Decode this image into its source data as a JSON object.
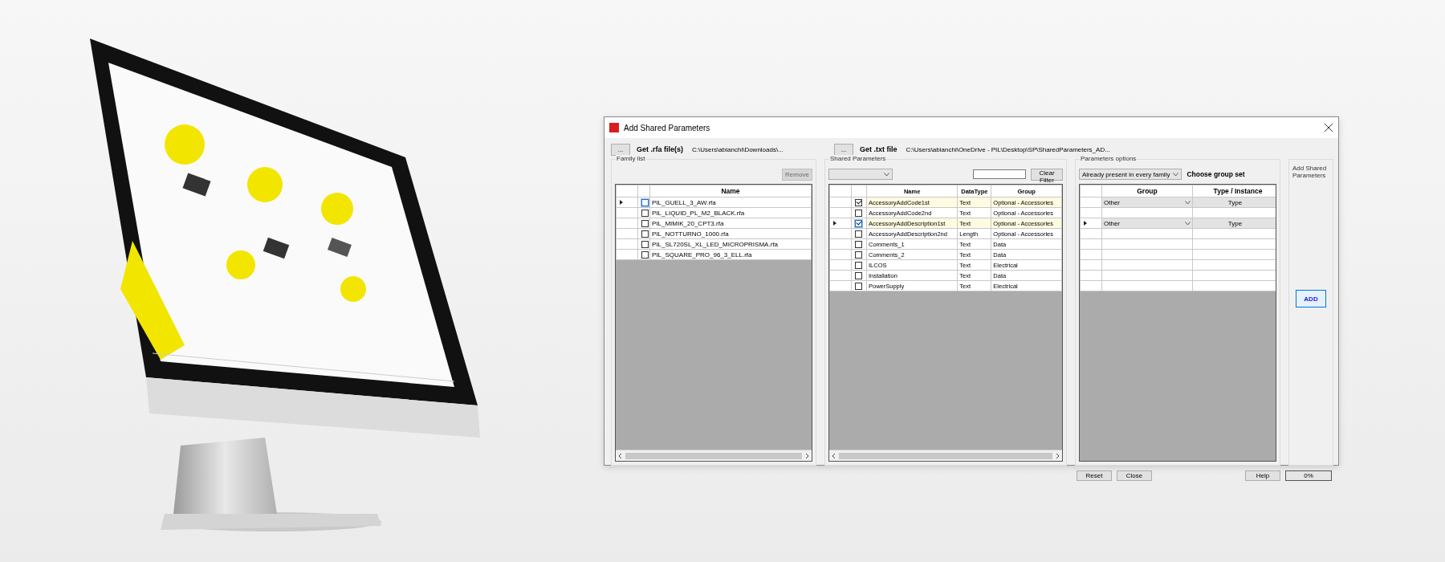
{
  "dialog": {
    "title": "Add Shared Parameters",
    "rfa_picker": {
      "button": "...",
      "label": "Get .rfa file(s)",
      "path": "C:\\Users\\abianchi\\Downloads\\..."
    },
    "txt_picker": {
      "button": "...",
      "label": "Get .txt file",
      "path": "C:\\Users\\abianchi\\OneDrive - PIL\\Desktop\\SP\\SharedParameters_AD..."
    },
    "family_list": {
      "title": "Family list",
      "remove_button": {
        "label": "Remove",
        "disabled": true
      },
      "columns": [
        "Name"
      ],
      "rows": [
        {
          "name": "PIL_GUELL_3_AW.rfa",
          "checked": false,
          "current": true
        },
        {
          "name": "PIL_LIQUID_PL_M2_BLACK.rfa",
          "checked": false,
          "current": false
        },
        {
          "name": "PIL_MIMIK_20_CPT3.rfa",
          "checked": false,
          "current": false
        },
        {
          "name": "PIL_NOTTURNO_1000.rfa",
          "checked": false,
          "current": false
        },
        {
          "name": "PIL_SL720SL_XL_LED_MICROPRISMA.rfa",
          "checked": false,
          "current": false
        },
        {
          "name": "PIL_SQUARE_PRO_96_3_ELL.rfa",
          "checked": false,
          "current": false
        }
      ]
    },
    "shared_parameters": {
      "title": "Shared Parameters",
      "clear_filter_button": "Clear Filter",
      "columns": [
        "Name",
        "DataType",
        "Group"
      ],
      "rows": [
        {
          "name": "AccessoryAddCode1st",
          "datatype": "Text",
          "group": "Optional - Accessories",
          "checked": true,
          "current": false
        },
        {
          "name": "AccessoryAddCode2nd",
          "datatype": "Text",
          "group": "Optional - Accessories",
          "checked": false,
          "current": false
        },
        {
          "name": "AccessoryAddDescription1st",
          "datatype": "Text",
          "group": "Optional - Accessories",
          "checked": true,
          "current": true
        },
        {
          "name": "AccessoryAddDescription2nd",
          "datatype": "Length",
          "group": "Optional - Accessories",
          "checked": false,
          "current": false
        },
        {
          "name": "Comments_1",
          "datatype": "Text",
          "group": "Data",
          "checked": false,
          "current": false
        },
        {
          "name": "Comments_2",
          "datatype": "Text",
          "group": "Data",
          "checked": false,
          "current": false
        },
        {
          "name": "ILCOS",
          "datatype": "Text",
          "group": "Electrical",
          "checked": false,
          "current": false
        },
        {
          "name": "Installation",
          "datatype": "Text",
          "group": "Data",
          "checked": false,
          "current": false
        },
        {
          "name": "PowerSupply",
          "datatype": "Text",
          "group": "Electrical",
          "checked": false,
          "current": false
        }
      ]
    },
    "parameters_options": {
      "title": "Parameters options",
      "mode": "Already present in every family",
      "choose_label": "Choose group set",
      "columns": [
        "Group",
        "Type / Instance"
      ],
      "rows": [
        {
          "kind": "combo",
          "group": "Other",
          "type": "Type",
          "current": false
        },
        {
          "kind": "blank",
          "current": false
        },
        {
          "kind": "combo",
          "group": "Other",
          "type": "Type",
          "current": true
        },
        {
          "kind": "blank",
          "current": false
        },
        {
          "kind": "blank",
          "current": false
        },
        {
          "kind": "blank",
          "current": false
        },
        {
          "kind": "blank",
          "current": false
        },
        {
          "kind": "blank",
          "current": false
        },
        {
          "kind": "blank",
          "current": false
        }
      ]
    },
    "add_panel": {
      "title": "Add Shared Parameters",
      "add_button": "ADD"
    },
    "buttons": [
      "Reset",
      "Close",
      "Help"
    ],
    "progress": {
      "text": "0%",
      "level": 0
    }
  }
}
